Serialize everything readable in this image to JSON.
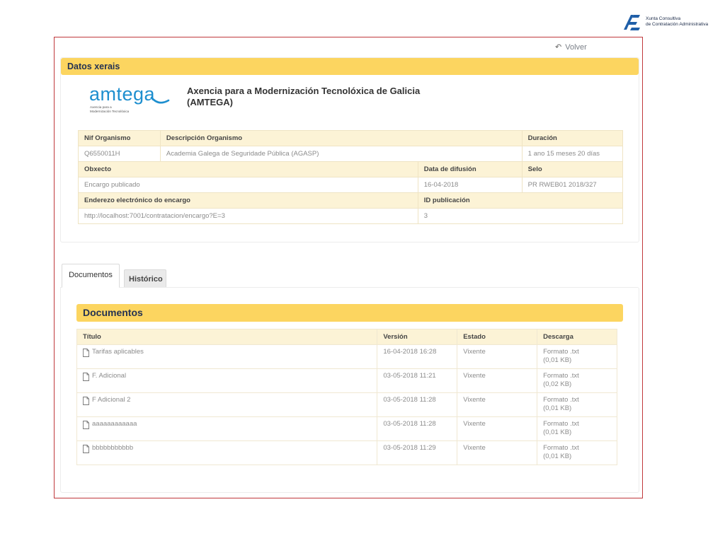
{
  "corp": {
    "line1": "Xunta Consultiva",
    "line2": "de Contratación Administrativa",
    "color": "#1f5fa8"
  },
  "nav": {
    "volver": "Volver",
    "icon": "undo-icon"
  },
  "datos": {
    "title": "Datos xerais",
    "logo": {
      "word": "amtega",
      "sub1": "Axencia para a",
      "sub2": "Modernización Tecnolóxica",
      "color": "#1e8fcf"
    },
    "org_name_line1": "Axencia para a Modernización Tecnolóxica de Galicia",
    "org_name_line2": "(AMTEGA)",
    "row1_headers": [
      "Nif Organismo",
      "Descripción Organismo",
      "Duración"
    ],
    "row1_values": [
      "Q6550011H",
      "Academia Galega de Seguridade Pública (AGASP)",
      "1 ano 15 meses 20 días"
    ],
    "row2_headers": [
      "Obxecto",
      "Data de difusión",
      "Selo"
    ],
    "row2_values": [
      "Encargo publicado",
      "16-04-2018",
      "PR RWEB01 2018/327"
    ],
    "row3_headers": [
      "Enderezo electrónico do encargo",
      "ID publicación"
    ],
    "row3_values": [
      "http://localhost:7001/contratacion/encargo?E=3",
      "3"
    ]
  },
  "tabs": [
    "Documentos",
    "Histórico"
  ],
  "documentos": {
    "title": "Documentos",
    "columns": [
      "Título",
      "Versión",
      "Estado",
      "Descarga"
    ],
    "rows": [
      {
        "titulo": "Tarifas aplicables",
        "version": "16-04-2018 16:28",
        "estado": "Vixente",
        "formato": "Formato .txt",
        "tamano": "(0,01 KB)"
      },
      {
        "titulo": "F. Adicional",
        "version": "03-05-2018 11:21",
        "estado": "Vixente",
        "formato": "Formato .txt",
        "tamano": "(0,02 KB)"
      },
      {
        "titulo": "F Adicional 2",
        "version": "03-05-2018 11:28",
        "estado": "Vixente",
        "formato": "Formato .txt",
        "tamano": "(0,01 KB)"
      },
      {
        "titulo": "aaaaaaaaaaaa",
        "version": "03-05-2018 11:28",
        "estado": "Vixente",
        "formato": "Formato .txt",
        "tamano": "(0,01 KB)"
      },
      {
        "titulo": "bbbbbbbbbbb",
        "version": "03-05-2018 11:29",
        "estado": "Vixente",
        "formato": "Formato .txt",
        "tamano": "(0,01 KB)"
      }
    ]
  },
  "colors": {
    "accent_yellow": "#fcd560",
    "header_bg": "#fcf3d6",
    "frame_red": "#c0383c",
    "title_navy": "#243252"
  }
}
